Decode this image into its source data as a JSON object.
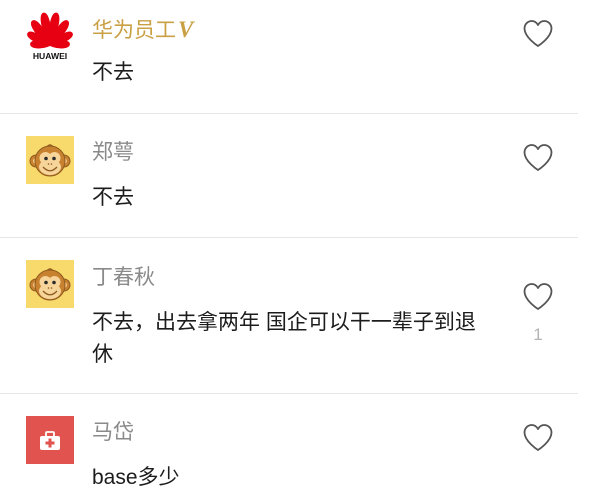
{
  "comments": [
    {
      "name": "华为员工",
      "badge": "V",
      "text": "不去",
      "avatar": {
        "icon": "huawei-logo",
        "logo_text": "HUAWEI"
      }
    },
    {
      "name": "郑萼",
      "text": "不去",
      "avatar": {
        "icon": "monkey-avatar"
      }
    },
    {
      "name": "丁春秋",
      "text": "不去，出去拿两年 国企可以干一辈子到退休",
      "avatar": {
        "icon": "monkey-avatar"
      },
      "likes": "1"
    },
    {
      "name": "马岱",
      "text": "base多少",
      "avatar": {
        "icon": "first-aid-kit-icon"
      }
    }
  ],
  "like_icon": "heart-outline-icon",
  "colors": {
    "verified_name": "#c9a044",
    "name": "#8a8a8a",
    "text": "#1c1c1c",
    "divider": "#e6e6e6",
    "icon": "#555555",
    "like_count": "#b3b3b3",
    "huawei_red": "#e60012",
    "avatar_yellow": "#f8d96c",
    "avatar_red": "#e0534f"
  }
}
